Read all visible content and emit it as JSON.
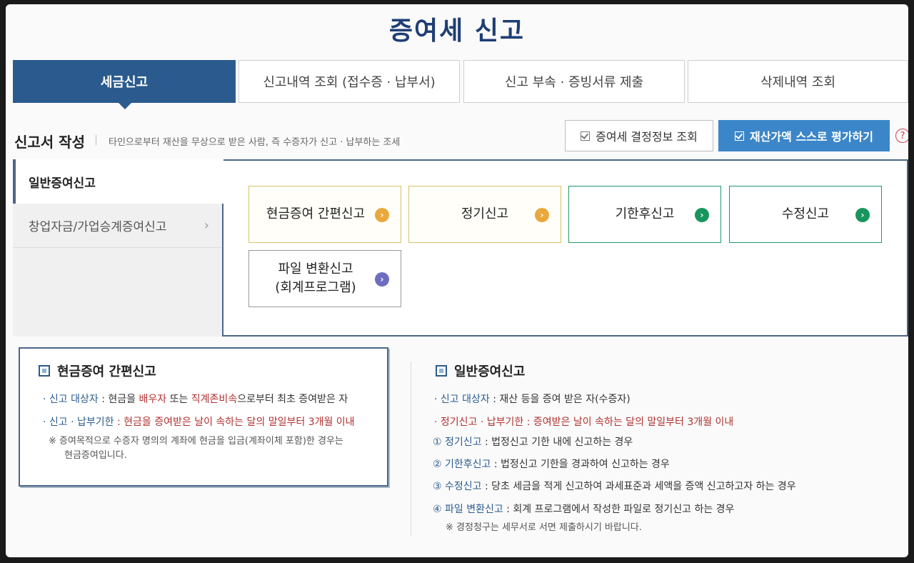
{
  "title": "증여세 신고",
  "tabs": [
    {
      "label": "세금신고",
      "active": true
    },
    {
      "label": "신고내역 조회 (접수증 · 납부서)",
      "active": false
    },
    {
      "label": "신고 부속 · 증빙서류 제출",
      "active": false
    },
    {
      "label": "삭제내역 조회",
      "active": false
    }
  ],
  "section": {
    "title": "신고서 작성",
    "desc": "타인으로부터 재산을 무상으로 받은 사람, 즉 수증자가 신고 · 납부하는 조세",
    "lookup_button": "증여세 결정정보 조회",
    "eval_button": "재산가액 스스로 평가하기",
    "help": "?"
  },
  "sidebar": {
    "items": [
      {
        "label": "일반증여신고"
      },
      {
        "label": "창업자금/가업승계증여신고",
        "chevron": "›"
      }
    ]
  },
  "cards": [
    {
      "label": "현금증여 간편신고",
      "color": "#e8a83c"
    },
    {
      "label": "정기신고",
      "color": "#e8a83c"
    },
    {
      "label": "기한후신고",
      "color": "#17955d"
    },
    {
      "label": "수정신고",
      "color": "#17955d"
    },
    {
      "label1": "파일 변환신고",
      "label2": "(회계프로그램)",
      "color": "#6e6ec0"
    }
  ],
  "cash_box": {
    "title": "현금증여 간편신고",
    "l1": {
      "k": "· 신고 대상자",
      "a": " : 현금을 ",
      "r1": "배우자",
      "b": " 또는 ",
      "r2": "직계존비속",
      "c": "으로부터 최초 증여받은 자"
    },
    "l2": {
      "k": "· 신고 · 납부기한",
      "r": " : 현금을 증여받은 날이 속하는 달의 말일부터 3개월 이내"
    },
    "note1": "※ 증여목적으로 수증자 명의의 계좌에 현금을 입금(계좌이체 포함)한 경우는",
    "note2": "현금증여입니다."
  },
  "general_box": {
    "title": "일반증여신고",
    "l1": {
      "k": "· 신고 대상자",
      "a": " : 재산 등을 증여 받은 자(수증자)"
    },
    "l2": {
      "k": "· 정기신고 · 납부기한",
      "r": " : 증여받은 날이 속하는 달의 말일부터 3개월 이내"
    },
    "items": [
      {
        "num": "①",
        "k": "정기신고",
        "t": " : 법정신고 기한 내에 신고하는 경우"
      },
      {
        "num": "②",
        "k": "기한후신고",
        "t": " : 법정신고 기한을 경과하여 신고하는 경우"
      },
      {
        "num": "③",
        "k": "수정신고",
        "t": " : 당초 세금을 적게 신고하여 과세표준과 세액을 증액 신고하고자 하는 경우"
      },
      {
        "num": "④",
        "k": "파일 변환신고",
        "t": " : 회계 프로그램에서 작성한 파일로 정기신고 하는 경우"
      }
    ],
    "note": "※ 경정청구는 세무서로 서면 제출하시기 바랍니다."
  }
}
